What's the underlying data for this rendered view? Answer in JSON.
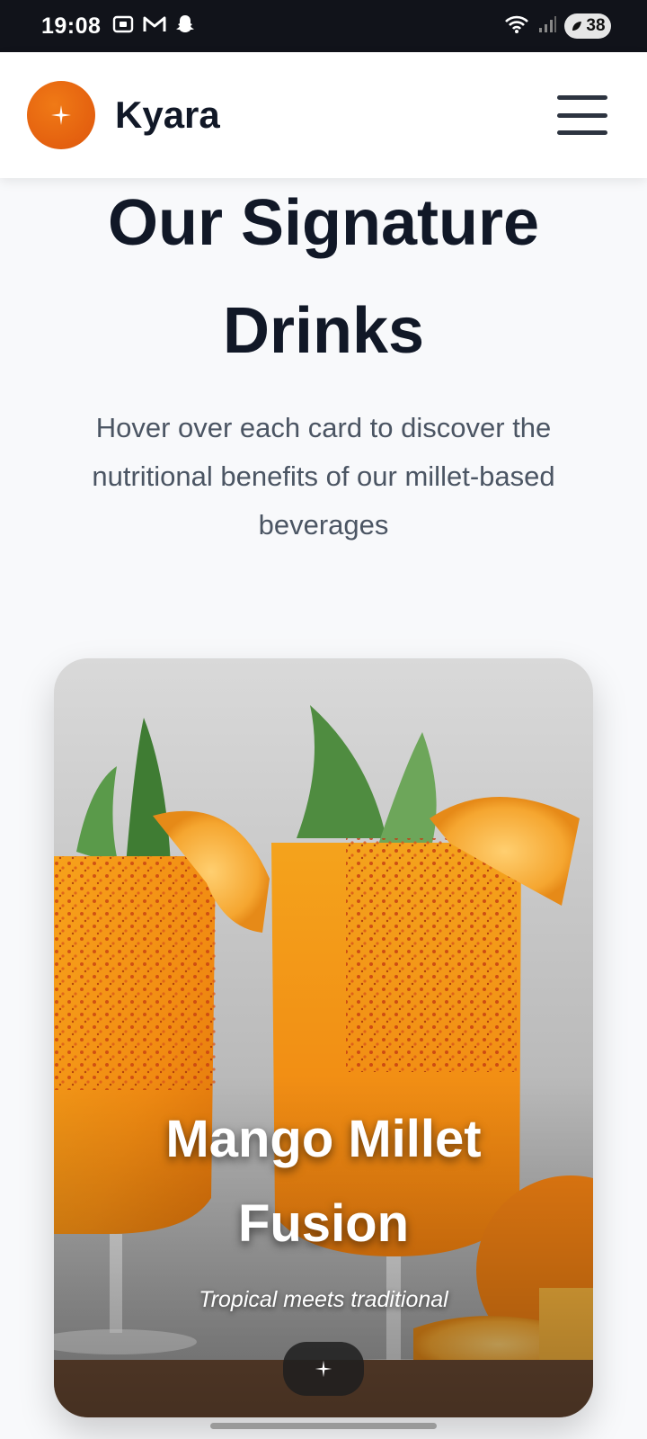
{
  "status_bar": {
    "time": "19:08",
    "battery": "38",
    "icons_left": [
      "screenshot-icon",
      "gmail-icon",
      "snapchat-icon"
    ],
    "icons_right": [
      "wifi-icon",
      "signal-icon",
      "battery-icon"
    ]
  },
  "header": {
    "brand": "Kyara",
    "logo_icon": "sparkle-icon",
    "menu_icon": "hamburger-menu-icon"
  },
  "hero": {
    "title_line1": "Our Signature",
    "title_line2": "Drinks",
    "subtitle_line1": "Hover over each card to discover the",
    "subtitle_line2": "nutritional benefits of our millet-based",
    "subtitle_line3": "beverages"
  },
  "card": {
    "title_line1": "Mango Millet",
    "title_line2": "Fusion",
    "tagline": "Tropical meets traditional",
    "action_icon": "sparkle-icon"
  },
  "colors": {
    "accent": "#e4600f",
    "heading": "#111827",
    "body_text": "#4b5563",
    "background": "#f8f9fb"
  }
}
